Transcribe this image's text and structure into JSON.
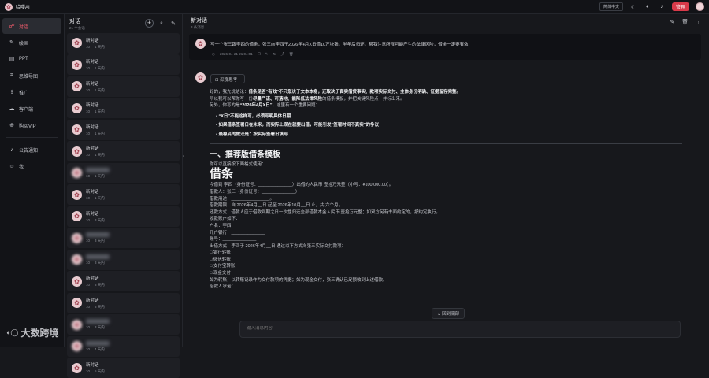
{
  "topbar": {
    "brand": "哈喽AI",
    "lang": "简体中文",
    "vip": "管理",
    "icons": [
      "moon-icon",
      "theme-icon",
      "bell-icon"
    ]
  },
  "sidebar": {
    "items": [
      {
        "label": "对话",
        "icon": "chat-icon",
        "active": true
      },
      {
        "label": "绘画",
        "icon": "brush-icon"
      },
      {
        "label": "PPT",
        "icon": "ppt-icon"
      },
      {
        "label": "思维导图",
        "icon": "mindmap-icon"
      },
      {
        "label": "推广",
        "icon": "share-icon"
      },
      {
        "label": "客户端",
        "icon": "cloud-icon"
      },
      {
        "label": "购买VIP",
        "icon": "cart-icon"
      }
    ],
    "items2": [
      {
        "label": "公告通知",
        "icon": "bell-icon"
      },
      {
        "label": "我",
        "icon": "user-icon"
      }
    ]
  },
  "convpanel": {
    "title": "对话",
    "subtitle": "21 个会话",
    "conversations": [
      {
        "title": "新对话",
        "count": "10",
        "time": "1 天内",
        "blur": false
      },
      {
        "title": "新对话",
        "count": "10",
        "time": "1 天内",
        "blur": false
      },
      {
        "title": "新对话",
        "count": "10",
        "time": "1 天内",
        "blur": false
      },
      {
        "title": "新对话",
        "count": "10",
        "time": "1 天内",
        "blur": false
      },
      {
        "title": "新对话",
        "count": "10",
        "time": "1 天内",
        "blur": false
      },
      {
        "title": "新对话",
        "count": "10",
        "time": "1 天内",
        "blur": false
      },
      {
        "title": "",
        "count": "10",
        "time": "1 天内",
        "blur": true
      },
      {
        "title": "新对话",
        "count": "10",
        "time": "1 天内",
        "blur": false
      },
      {
        "title": "新对话",
        "count": "10",
        "time": "3 天内",
        "blur": false
      },
      {
        "title": "",
        "count": "10",
        "time": "3 天内",
        "blur": true
      },
      {
        "title": "",
        "count": "10",
        "time": "3 天内",
        "blur": true
      },
      {
        "title": "新对话",
        "count": "10",
        "time": "3 天内",
        "blur": false
      },
      {
        "title": "新对话",
        "count": "10",
        "time": "3 天内",
        "blur": false
      },
      {
        "title": "",
        "count": "10",
        "time": "3 天内",
        "blur": true
      },
      {
        "title": "",
        "count": "10",
        "time": "4 天内",
        "blur": true
      },
      {
        "title": "新对话",
        "count": "10",
        "time": "5 天内",
        "blur": false
      }
    ]
  },
  "main": {
    "title": "新对话",
    "subtitle": "3 条消息",
    "question": "写一个张三跟李四的借条，张三向李四于2026年4月X日借10万块钱，半年后归还，帮我注意所有可能产生的法律风险，借条一定要有效",
    "question_time": "2026-04-21 21:04:01",
    "think_label": "深度思考",
    "answer": {
      "p1a": "好的，我先说结论：",
      "p1b": "借条是否“有效”不只取决于文本本身，还取决于真实借贷事实、款项实际交付、主体身份明确、证据留存完整。",
      "p2a": "所以我可以帮你写一份",
      "p2b": "尽量严谨、可落地、能降低法律风险",
      "p2c": "的借条模板，并把关键风险点一并标出来。",
      "p3a": "另外，你写的是",
      "p3b": "“2026年4月X日”",
      "p3c": "，这里有一个重要问题：",
      "bullets": [
        "“X日”不能这样写，必须写明具体日期",
        "如果借条签署日在未来，而实际上现在就要出借，可能引发“签署时间不真实”的争议",
        "最稳妥的做法是：按实际签署日填写"
      ],
      "h2": "一、推荐版借条模板",
      "intro": "你可以直接按下面格式使用：",
      "h1": "借条",
      "lines": [
        "今借到 李四（身份证号：______________）出借的人民币 壹拾万元整（小写：¥100,000.00）。",
        "借款人：张三（身份证号：______________）",
        "借款用途：________________。",
        "借款期限：自 2026年4月__日 起至 2026年10月__日 止，共 六个月。",
        "还款方式：借款人应于借款到期之日一次性归还全部借款本金人民币 壹拾万元整；如双方另有书面约定的，按约定执行。",
        "收款账户如下：",
        "户名：李四",
        "开户银行：______________",
        "账号：______________",
        "出借方式：李四于 2026年4月__日 通过以下方式向张三实际交付款项：",
        "□ 银行转账",
        "□ 微信转账",
        "□ 支付宝转账",
        "□ 现金交付",
        "如为转账，以转账记录作为交付款项的凭据；如为现金交付，张三确认已足额收到上述借款。",
        "借款人承诺："
      ]
    },
    "back_bottom": "回到底部",
    "composer_placeholder": "输入消息内容"
  },
  "watermark": "大数跨境"
}
